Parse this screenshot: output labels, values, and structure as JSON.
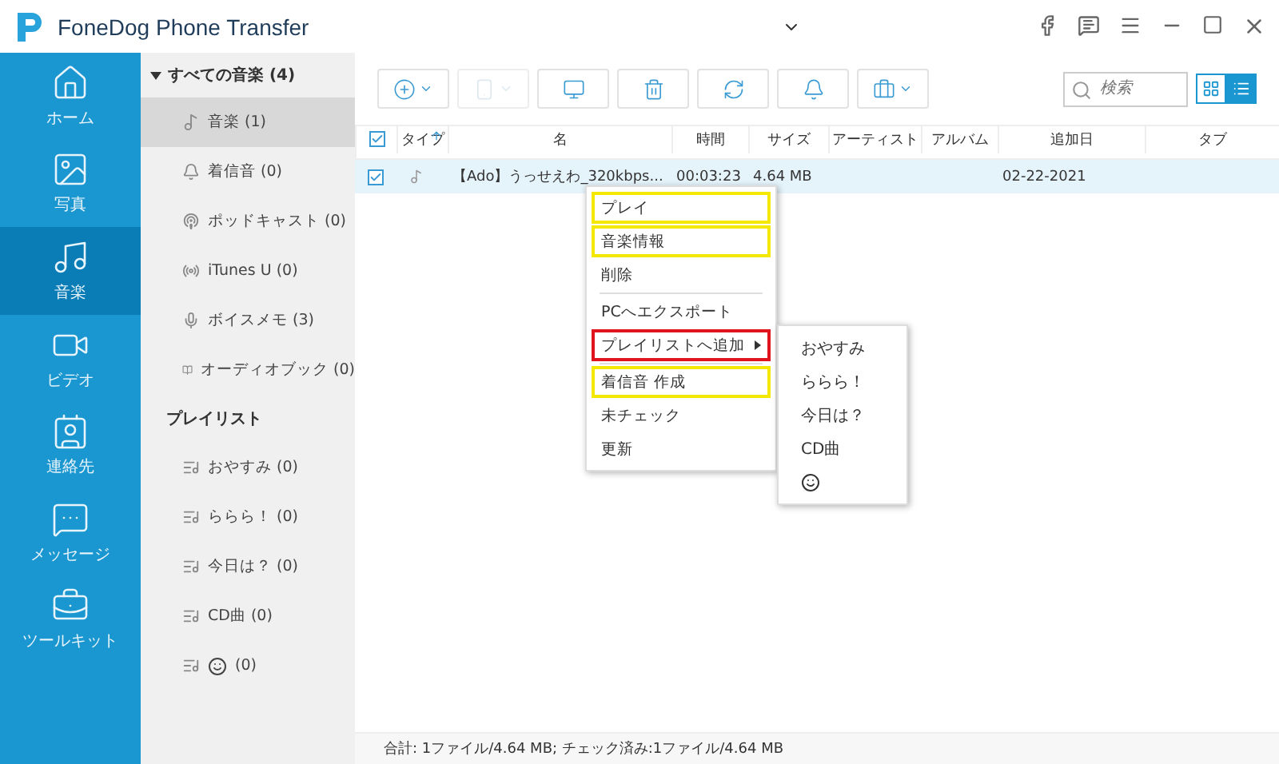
{
  "window": {
    "title": "FoneDog Phone Transfer"
  },
  "nav": [
    {
      "label": "ホーム",
      "selected": false
    },
    {
      "label": "写真",
      "selected": false
    },
    {
      "label": "音楽",
      "selected": true
    },
    {
      "label": "ビデオ",
      "selected": false
    },
    {
      "label": "連絡先",
      "selected": false
    },
    {
      "label": "メッセージ",
      "selected": false
    },
    {
      "label": "ツールキット",
      "selected": false
    }
  ],
  "categories": {
    "header": "すべての音楽 (4)",
    "expanded": true,
    "items": [
      {
        "label": "音楽 (1)",
        "selected": true
      },
      {
        "label": "着信音 (0)",
        "selected": false
      },
      {
        "label": "ポッドキャスト (0)",
        "selected": false
      },
      {
        "label": "iTunes U (0)",
        "selected": false
      },
      {
        "label": "ボイスメモ (3)",
        "selected": false
      },
      {
        "label": "オーディオブック (0)",
        "selected": false
      }
    ]
  },
  "playlists": {
    "header": "プレイリスト",
    "items": [
      {
        "kind": "text",
        "label": "おやすみ (0)"
      },
      {
        "kind": "text",
        "label": "ららら！ (0)"
      },
      {
        "kind": "text",
        "label": "今日は？ (0)"
      },
      {
        "kind": "text",
        "label": "CD曲 (0)"
      },
      {
        "kind": "emoji",
        "label": "(0)"
      }
    ]
  },
  "toolbar": [
    {
      "dropdown": true,
      "disabled": false
    },
    {
      "dropdown": true,
      "disabled": true
    },
    {
      "dropdown": false,
      "disabled": false
    },
    {
      "dropdown": false,
      "disabled": false
    },
    {
      "dropdown": false,
      "disabled": false
    },
    {
      "dropdown": false,
      "disabled": false
    },
    {
      "dropdown": true,
      "disabled": false
    }
  ],
  "search": {
    "placeholder": "検索"
  },
  "view": [
    {
      "selected": false
    },
    {
      "selected": true
    }
  ],
  "table": {
    "all_checked": true,
    "columns": [
      "タイプ",
      "名",
      "時間",
      "サイズ",
      "アーティスト",
      "アルバム",
      "追加日",
      "タブ"
    ],
    "rows": [
      {
        "checked": true,
        "selected": true,
        "cells": [
          "",
          "【Ado】うっせえわ_320kbps...",
          "00:03:23",
          "4.64 MB",
          "",
          "",
          "02-22-2021",
          ""
        ]
      }
    ]
  },
  "context_menu": [
    {
      "kind": "item",
      "label": "プレイ",
      "color": "#f5e800"
    },
    {
      "kind": "item",
      "label": "音楽情報",
      "color": "#f5e800"
    },
    {
      "kind": "item",
      "label": "削除"
    },
    {
      "kind": "divider"
    },
    {
      "kind": "item",
      "label": "PCへエクスポート"
    },
    {
      "kind": "submenu",
      "label": "プレイリストへ追加",
      "color": "#e0141e"
    },
    {
      "kind": "divider"
    },
    {
      "kind": "item",
      "label": "着信音 作成",
      "color": "#f5e800"
    },
    {
      "kind": "item",
      "label": "未チェック"
    },
    {
      "kind": "item",
      "label": "更新"
    }
  ],
  "submenu": [
    {
      "kind": "text",
      "label": "おやすみ"
    },
    {
      "kind": "text",
      "label": "ららら！"
    },
    {
      "kind": "text",
      "label": "今日は？"
    },
    {
      "kind": "text",
      "label": "CD曲"
    },
    {
      "kind": "emoji"
    }
  ],
  "status_bar": "合計: 1ファイル/4.64 MB; チェック済み:1ファイル/4.64 MB"
}
